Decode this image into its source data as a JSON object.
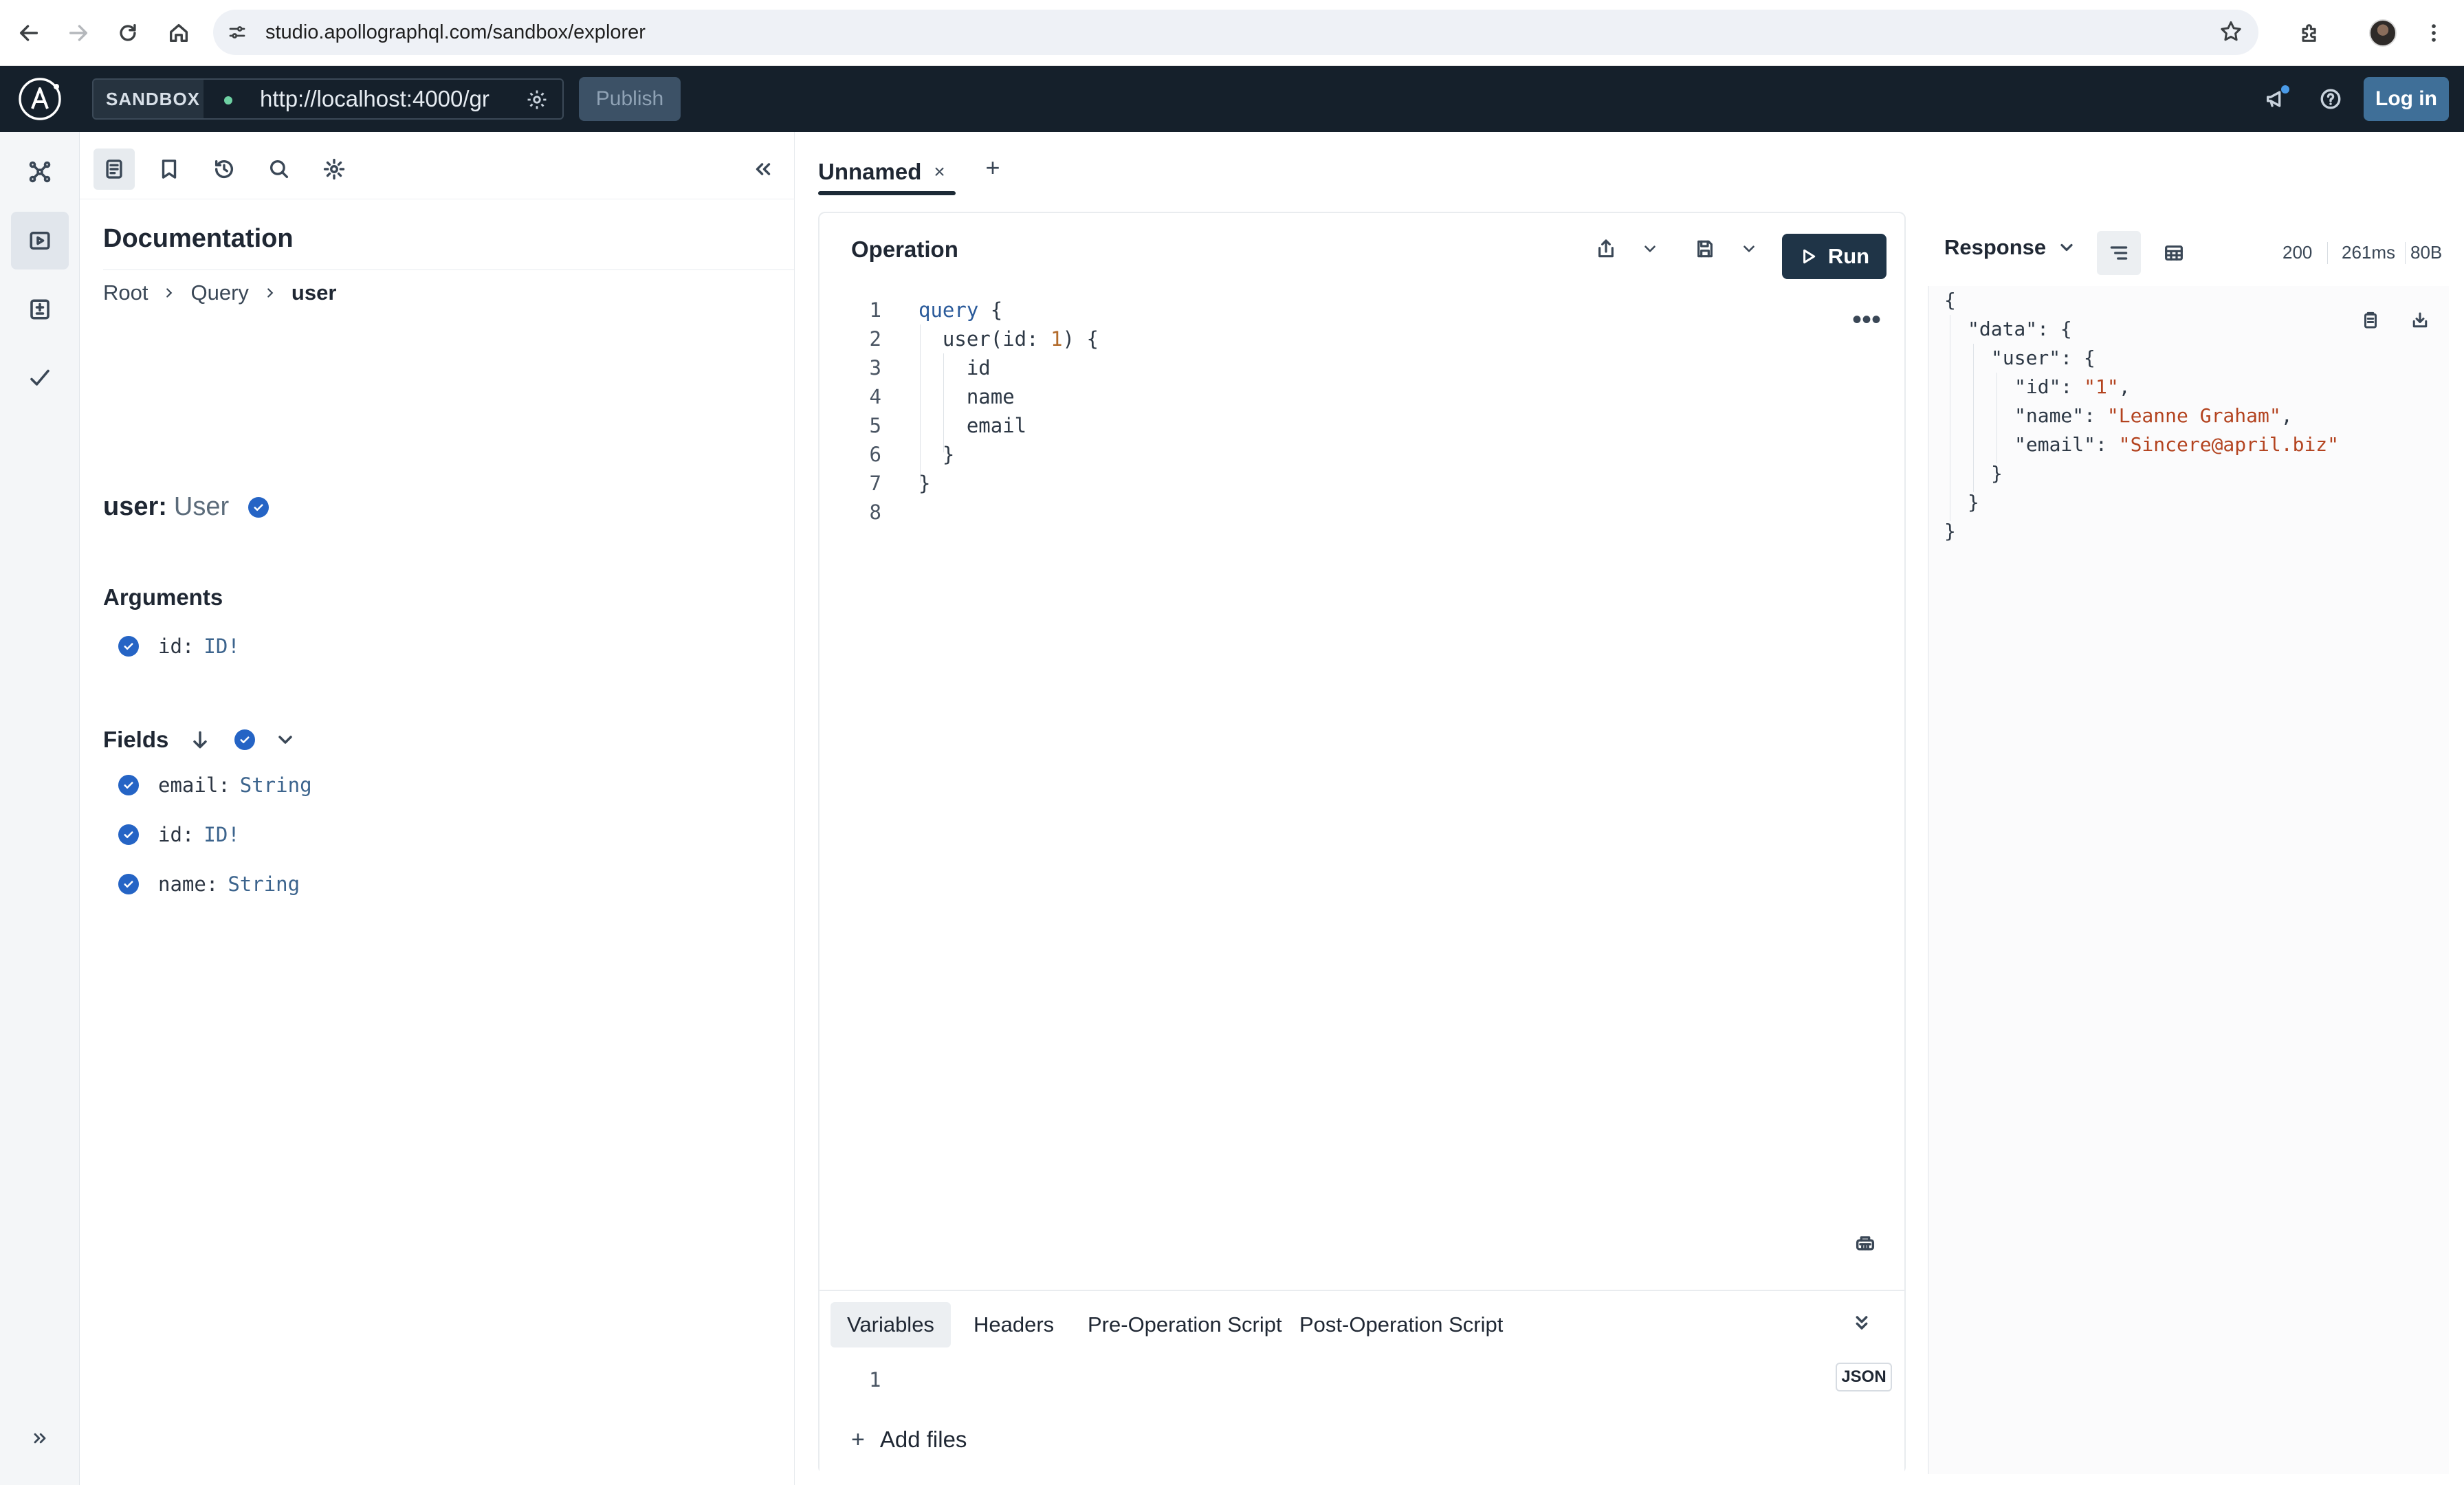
{
  "browser": {
    "url": "studio.apollographql.com/sandbox/explorer"
  },
  "header": {
    "badge": "SANDBOX",
    "endpoint": "http://localhost:4000/gr",
    "publish_label": "Publish",
    "login_label": "Log in"
  },
  "docs": {
    "title": "Documentation",
    "breadcrumb": [
      "Root",
      "Query",
      "user"
    ],
    "field_name": "user:",
    "field_type": "User",
    "arguments_title": "Arguments",
    "arguments": [
      {
        "name": "id:",
        "type": "ID!"
      }
    ],
    "fields_title": "Fields",
    "fields": [
      {
        "name": "email:",
        "type": "String"
      },
      {
        "name": "id:",
        "type": "ID!"
      },
      {
        "name": "name:",
        "type": "String"
      }
    ]
  },
  "tabs": {
    "items": [
      {
        "label": "Unnamed",
        "close": "×"
      }
    ],
    "add": "+"
  },
  "operation": {
    "title": "Operation",
    "run_label": "Run",
    "more": "•••",
    "lines": [
      {
        "n": "1",
        "parts": [
          [
            "kw",
            "query"
          ],
          [
            "",
            " {"
          ]
        ]
      },
      {
        "n": "2",
        "parts": [
          [
            "",
            "  user(id: "
          ],
          [
            "num",
            "1"
          ],
          [
            "",
            ") {"
          ]
        ]
      },
      {
        "n": "3",
        "parts": [
          [
            "",
            "    id"
          ]
        ]
      },
      {
        "n": "4",
        "parts": [
          [
            "",
            "    name"
          ]
        ]
      },
      {
        "n": "5",
        "parts": [
          [
            "",
            "    email"
          ]
        ]
      },
      {
        "n": "6",
        "parts": [
          [
            "",
            "  }"
          ]
        ]
      },
      {
        "n": "7",
        "parts": [
          [
            "",
            "}"
          ]
        ]
      },
      {
        "n": "8",
        "parts": [
          [
            "",
            ""
          ]
        ]
      }
    ]
  },
  "variables": {
    "tabs": [
      "Variables",
      "Headers",
      "Pre-Operation Script",
      "Post-Operation Script"
    ],
    "badge": "JSON",
    "line_number": "1",
    "add_files": "Add files"
  },
  "response": {
    "title": "Response",
    "status": "200",
    "time": "261ms",
    "size": "80B",
    "lines": [
      {
        "indent": 0,
        "parts": [
          [
            "",
            "{"
          ]
        ]
      },
      {
        "indent": 1,
        "parts": [
          [
            "",
            "\"data\": {"
          ]
        ]
      },
      {
        "indent": 2,
        "parts": [
          [
            "",
            "\"user\": {"
          ]
        ]
      },
      {
        "indent": 3,
        "parts": [
          [
            "",
            "\"id\": "
          ],
          [
            "str",
            "\"1\""
          ],
          [
            "",
            ","
          ]
        ]
      },
      {
        "indent": 3,
        "parts": [
          [
            "",
            "\"name\": "
          ],
          [
            "str",
            "\"Leanne Graham\""
          ],
          [
            "",
            ","
          ]
        ]
      },
      {
        "indent": 3,
        "parts": [
          [
            "",
            "\"email\": "
          ],
          [
            "str",
            "\"Sincere@april.biz\""
          ]
        ]
      },
      {
        "indent": 2,
        "parts": [
          [
            "",
            "}"
          ]
        ]
      },
      {
        "indent": 1,
        "parts": [
          [
            "",
            "}"
          ]
        ]
      },
      {
        "indent": 0,
        "parts": [
          [
            "",
            "}"
          ]
        ]
      }
    ]
  }
}
